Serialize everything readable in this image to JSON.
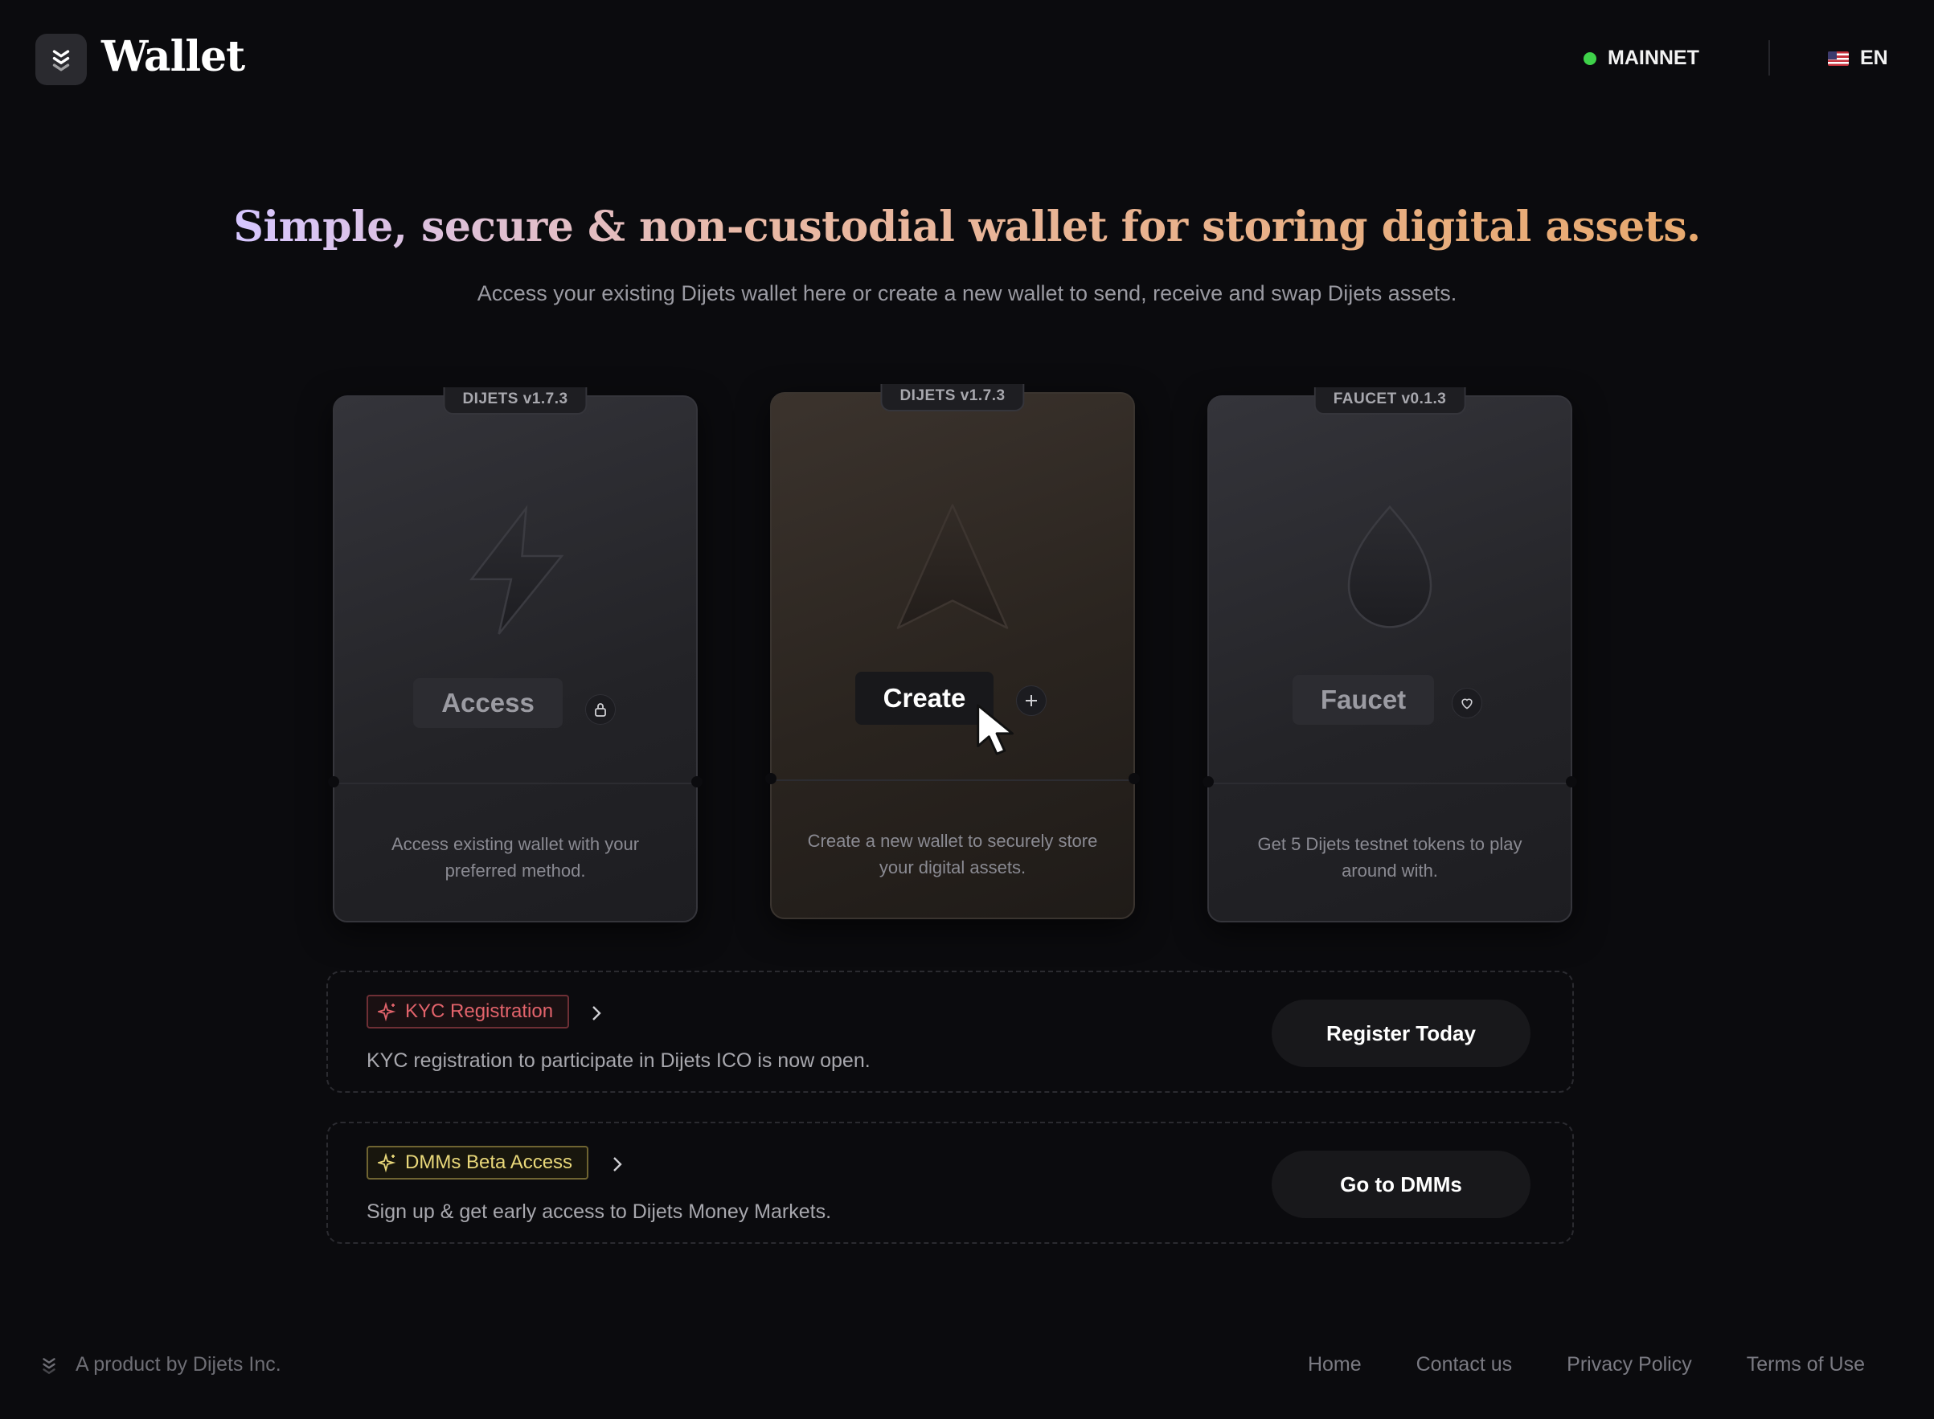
{
  "header": {
    "brand": "Wallet",
    "network": "MAINNET",
    "network_color": "#3fd24a",
    "language": "EN",
    "logo_icon": "layers-logo-icon",
    "flag_icon": "us-flag-icon"
  },
  "hero": {
    "headline": "Simple, secure & non-custodial wallet for storing digital assets.",
    "subhead": "Access your existing Dijets wallet here or create a new wallet to send, receive and swap Dijets assets."
  },
  "cards": [
    {
      "tag": "DIJETS v1.7.3",
      "label": "Access",
      "icon": "lightning-icon",
      "action_icon": "lock-icon",
      "description": "Access existing wallet with your preferred method."
    },
    {
      "tag": "DIJETS v1.7.3",
      "label": "Create",
      "icon": "navigation-arrow-icon",
      "action_icon": "plus-icon",
      "description": "Create a new wallet to securely store your digital assets."
    },
    {
      "tag": "FAUCET v0.1.3",
      "label": "Faucet",
      "icon": "droplet-icon",
      "action_icon": "heart-icon",
      "description": "Get 5 Dijets testnet tokens to play around with."
    }
  ],
  "promos": [
    {
      "badge": "KYC Registration",
      "text": "KYC registration to participate in Dijets ICO is now open.",
      "button": "Register Today",
      "badge_color": "#e2636b"
    },
    {
      "badge": "DMMs Beta Access",
      "text": "Sign up & get early access to Dijets Money Markets.",
      "button": "Go to DMMs",
      "badge_color": "#e9d87a"
    }
  ],
  "footer": {
    "product": "A product by Dijets Inc.",
    "links": [
      "Home",
      "Contact us",
      "Privacy Policy",
      "Terms of Use"
    ]
  }
}
